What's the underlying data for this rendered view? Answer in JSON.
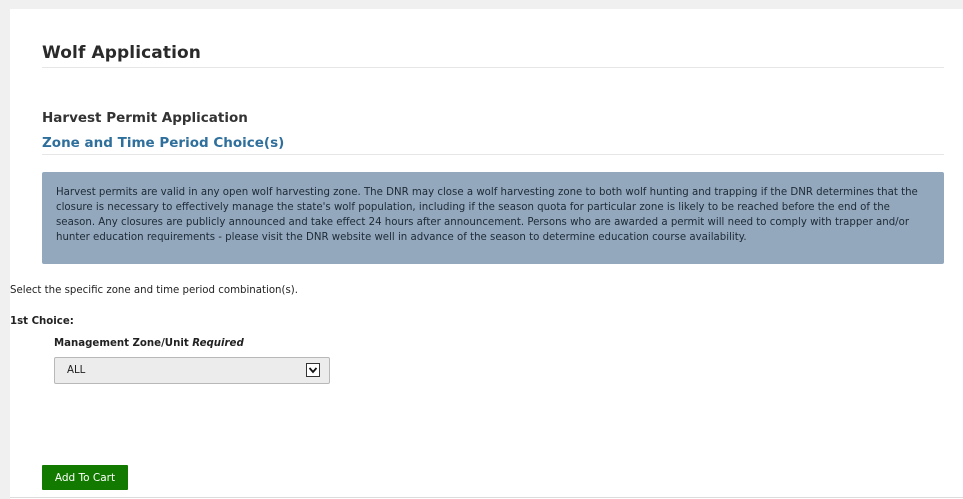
{
  "page": {
    "title": "Wolf Application"
  },
  "section": {
    "title": "Harvest Permit Application",
    "subtitle": "Zone and Time Period Choice(s)"
  },
  "notice": {
    "text": "Harvest permits are valid in any open wolf harvesting zone. The DNR may close a wolf harvesting zone to both wolf hunting and trapping if the DNR determines that the closure is necessary to effectively manage the state's wolf population, including if the season quota for particular zone is likely to be reached before the end of the season. Any closures are publicly announced and take effect 24 hours after announcement. Persons who are awarded a permit will need to comply with trapper and/or hunter education requirements - please visit the DNR website well in advance of the season to determine education course availability."
  },
  "form": {
    "instructions": "Select the specific zone and time period combination(s).",
    "choice_label": "1st Choice:",
    "zone_field": {
      "label": "Management Zone/Unit",
      "required_text": "Required",
      "selected_value": "ALL",
      "arrow_icon": "chevron-down-icon"
    }
  },
  "actions": {
    "add_to_cart_label": "Add To Cart",
    "add_to_cart_color": "#137a00"
  },
  "colors": {
    "notice_background": "#93a8bd",
    "subtitle_color": "#2e6f9c"
  }
}
